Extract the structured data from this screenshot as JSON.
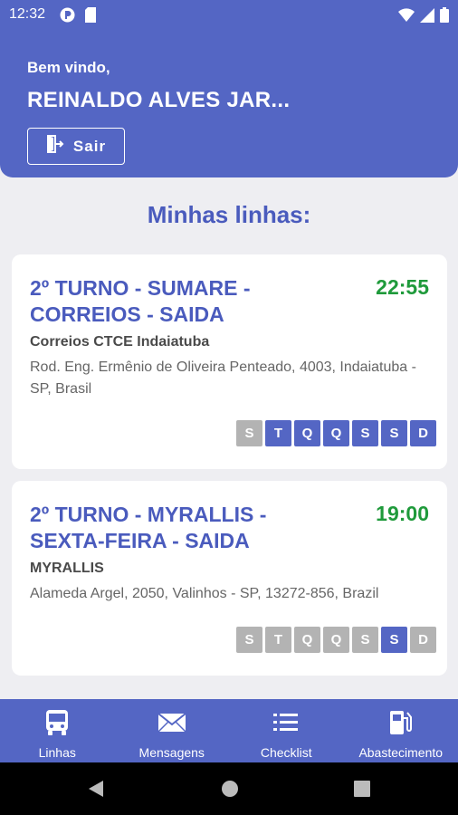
{
  "status_bar": {
    "time": "12:32"
  },
  "header": {
    "welcome": "Bem vindo,",
    "user_name": "REINALDO ALVES JAR...",
    "logout_label": "Sair"
  },
  "section_title": "Minhas linhas:",
  "routes": [
    {
      "title": "2º TURNO - SUMARE - CORREIOS - SAIDA",
      "time": "22:55",
      "place": "Correios CTCE Indaiatuba",
      "address": "Rod. Eng. Ermênio de Oliveira Penteado, 4003, Indaiatuba - SP, Brasil",
      "days": [
        {
          "label": "S",
          "active": false
        },
        {
          "label": "T",
          "active": true
        },
        {
          "label": "Q",
          "active": true
        },
        {
          "label": "Q",
          "active": true
        },
        {
          "label": "S",
          "active": true
        },
        {
          "label": "S",
          "active": true
        },
        {
          "label": "D",
          "active": true
        }
      ]
    },
    {
      "title": "2º TURNO - MYRALLIS - SEXTA-FEIRA - SAIDA",
      "time": "19:00",
      "place": "MYRALLIS",
      "address": "Alameda Argel, 2050, Valinhos - SP, 13272-856, Brazil",
      "days": [
        {
          "label": "S",
          "active": false
        },
        {
          "label": "T",
          "active": false
        },
        {
          "label": "Q",
          "active": false
        },
        {
          "label": "Q",
          "active": false
        },
        {
          "label": "S",
          "active": false
        },
        {
          "label": "S",
          "active": true
        },
        {
          "label": "D",
          "active": false
        }
      ]
    }
  ],
  "bottom_nav": [
    {
      "label": "Linhas",
      "icon": "bus-icon"
    },
    {
      "label": "Mensagens",
      "icon": "envelope-icon"
    },
    {
      "label": "Checklist",
      "icon": "list-icon"
    },
    {
      "label": "Abastecimento",
      "icon": "fuel-pump-icon"
    }
  ],
  "colors": {
    "primary": "#5466c4",
    "title_blue": "#4a5bbd",
    "time_green": "#1f9a3b",
    "day_inactive": "#b3b3b3",
    "background": "#eeeef2"
  }
}
